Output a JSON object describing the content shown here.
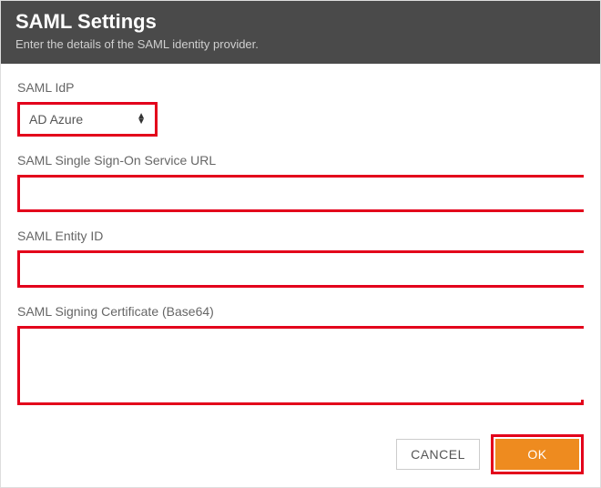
{
  "header": {
    "title": "SAML Settings",
    "subtitle": "Enter the details of the SAML identity provider."
  },
  "fields": {
    "idp": {
      "label": "SAML IdP",
      "selected": "AD Azure"
    },
    "sso_url": {
      "label": "SAML Single Sign-On Service URL",
      "value": ""
    },
    "entity_id": {
      "label": "SAML Entity ID",
      "value": ""
    },
    "signing_cert": {
      "label": "SAML Signing Certificate (Base64)",
      "value": ""
    }
  },
  "buttons": {
    "cancel": "CANCEL",
    "ok": "OK"
  },
  "colors": {
    "highlight": "#e3001b",
    "primary": "#ee8b1f",
    "header_bg": "#4a4a4a"
  }
}
